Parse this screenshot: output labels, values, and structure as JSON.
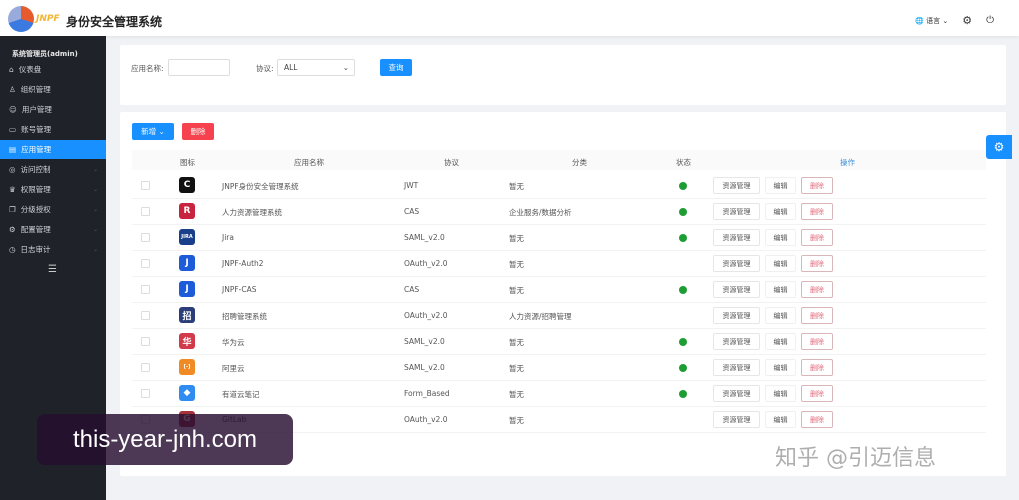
{
  "header": {
    "logo_text": "JNPF",
    "title": "身份安全管理系统",
    "language": "语言",
    "settings_icon": "gear-icon",
    "logout_icon": "power-icon"
  },
  "sidebar": {
    "user": "系统管理员(admin)",
    "items": [
      {
        "label": "仪表盘",
        "icon": "home-icon"
      },
      {
        "label": "组织管理",
        "icon": "org-icon"
      },
      {
        "label": "用户管理",
        "icon": "user-icon"
      },
      {
        "label": "账号管理",
        "icon": "card-icon"
      },
      {
        "label": "应用管理",
        "icon": "app-icon",
        "active": true
      },
      {
        "label": "访问控制",
        "icon": "shield-icon"
      },
      {
        "label": "权限管理",
        "icon": "key-icon"
      },
      {
        "label": "分级授权",
        "icon": "layers-icon"
      },
      {
        "label": "配置管理",
        "icon": "gear-icon"
      },
      {
        "label": "日志审计",
        "icon": "clock-icon"
      }
    ]
  },
  "search": {
    "name_label": "应用名称:",
    "name_value": "",
    "protocol_label": "协议:",
    "protocol_value": "ALL",
    "query_button": "查询"
  },
  "toolbar": {
    "add_button": "新增",
    "delete_button": "删除"
  },
  "table": {
    "headers": [
      "图标",
      "应用名称",
      "协议",
      "分类",
      "状态",
      "操作"
    ],
    "rows": [
      {
        "icon": "C",
        "icon_color": "#111111",
        "name": "JNPF身份安全管理系统",
        "protocol": "JWT",
        "category": "暂无",
        "enabled": true
      },
      {
        "icon": "R",
        "icon_color": "#c9243f",
        "name": "人力资源管理系统",
        "protocol": "CAS",
        "category": "企业服务/数据分析",
        "enabled": true
      },
      {
        "icon": "JIRA",
        "icon_color": "#1a3f8a",
        "name": "Jira",
        "protocol": "SAML_v2.0",
        "category": "暂无",
        "enabled": true
      },
      {
        "icon": "J",
        "icon_color": "#1e5bd8",
        "name": "JNPF-Auth2",
        "protocol": "OAuth_v2.0",
        "category": "暂无",
        "enabled": false
      },
      {
        "icon": "J",
        "icon_color": "#1e5bd8",
        "name": "JNPF-CAS",
        "protocol": "CAS",
        "category": "暂无",
        "enabled": true
      },
      {
        "icon": "招",
        "icon_color": "#2c3e7a",
        "name": "招聘管理系统",
        "protocol": "OAuth_v2.0",
        "category": "人力资源/招聘管理",
        "enabled": false
      },
      {
        "icon": "华",
        "icon_color": "#d2394a",
        "name": "华为云",
        "protocol": "SAML_v2.0",
        "category": "暂无",
        "enabled": true
      },
      {
        "icon": "[-]",
        "icon_color": "#f08a24",
        "name": "阿里云",
        "protocol": "SAML_v2.0",
        "category": "暂无",
        "enabled": true
      },
      {
        "icon": "◆",
        "icon_color": "#2f8cf0",
        "name": "有道云笔记",
        "protocol": "Form_Based",
        "category": "暂无",
        "enabled": true
      },
      {
        "icon": "G",
        "icon_color": "#a8323c",
        "name": "GitLab",
        "protocol": "OAuth_v2.0",
        "category": "暂无",
        "enabled": false
      }
    ],
    "actions": {
      "resource": "资源管理",
      "edit": "编辑",
      "delete": "删除"
    }
  },
  "watermarks": {
    "site": "this-year-jnh.com",
    "zhihu": "知乎 @引迈信息"
  },
  "colors": {
    "primary": "#1890ff",
    "danger": "#f5424e",
    "sidebar": "#1f2329",
    "success": "#1f9d35"
  }
}
